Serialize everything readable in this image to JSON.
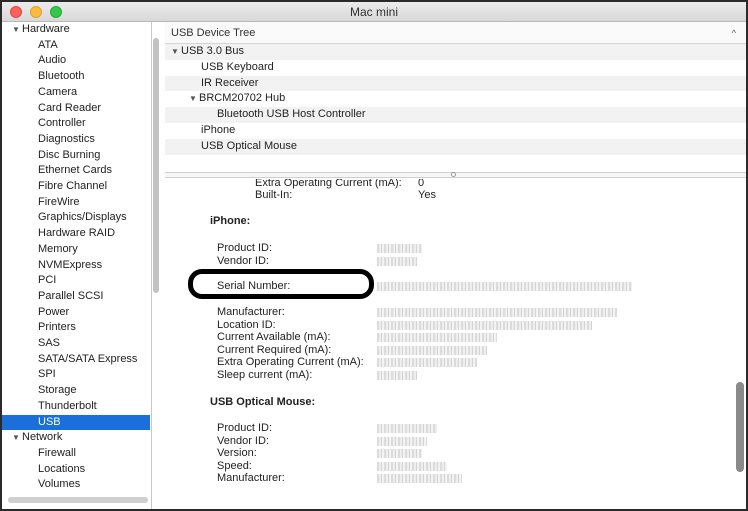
{
  "window": {
    "title": "Mac mini"
  },
  "sidebar": {
    "categories": [
      {
        "label": "Hardware",
        "items": [
          "ATA",
          "Audio",
          "Bluetooth",
          "Camera",
          "Card Reader",
          "Controller",
          "Diagnostics",
          "Disc Burning",
          "Ethernet Cards",
          "Fibre Channel",
          "FireWire",
          "Graphics/Displays",
          "Hardware RAID",
          "Memory",
          "NVMExpress",
          "PCI",
          "Parallel SCSI",
          "Power",
          "Printers",
          "SAS",
          "SATA/SATA Express",
          "SPI",
          "Storage",
          "Thunderbolt",
          "USB"
        ]
      },
      {
        "label": "Network",
        "items": [
          "Firewall",
          "Locations",
          "Volumes"
        ]
      }
    ],
    "selected": "USB"
  },
  "tree": {
    "header": "USB Device Tree",
    "rows": [
      "USB 3.0 Bus",
      "USB Keyboard",
      "IR Receiver",
      "BRCM20702 Hub",
      "Bluetooth USB Host Controller",
      "iPhone",
      "USB Optical Mouse"
    ]
  },
  "detail": {
    "top": [
      {
        "label": "Extra Operating Current (mA):",
        "value": "0"
      },
      {
        "label": "Built-In:",
        "value": "Yes"
      }
    ],
    "iphone": {
      "title": "iPhone:",
      "fields": [
        "Product ID:",
        "Vendor ID:",
        "Serial Number:",
        "Manufacturer:",
        "Location ID:",
        "Current Available (mA):",
        "Current Required (mA):",
        "Extra Operating Current (mA):",
        "Sleep current (mA):"
      ]
    },
    "mouse": {
      "title": "USB Optical Mouse:",
      "fields": [
        "Product ID:",
        "Vendor ID:",
        "Version:",
        "Speed:",
        "Manufacturer:"
      ]
    }
  },
  "icons": {
    "disclosure_open": "▼",
    "collapse_caret": "^"
  }
}
